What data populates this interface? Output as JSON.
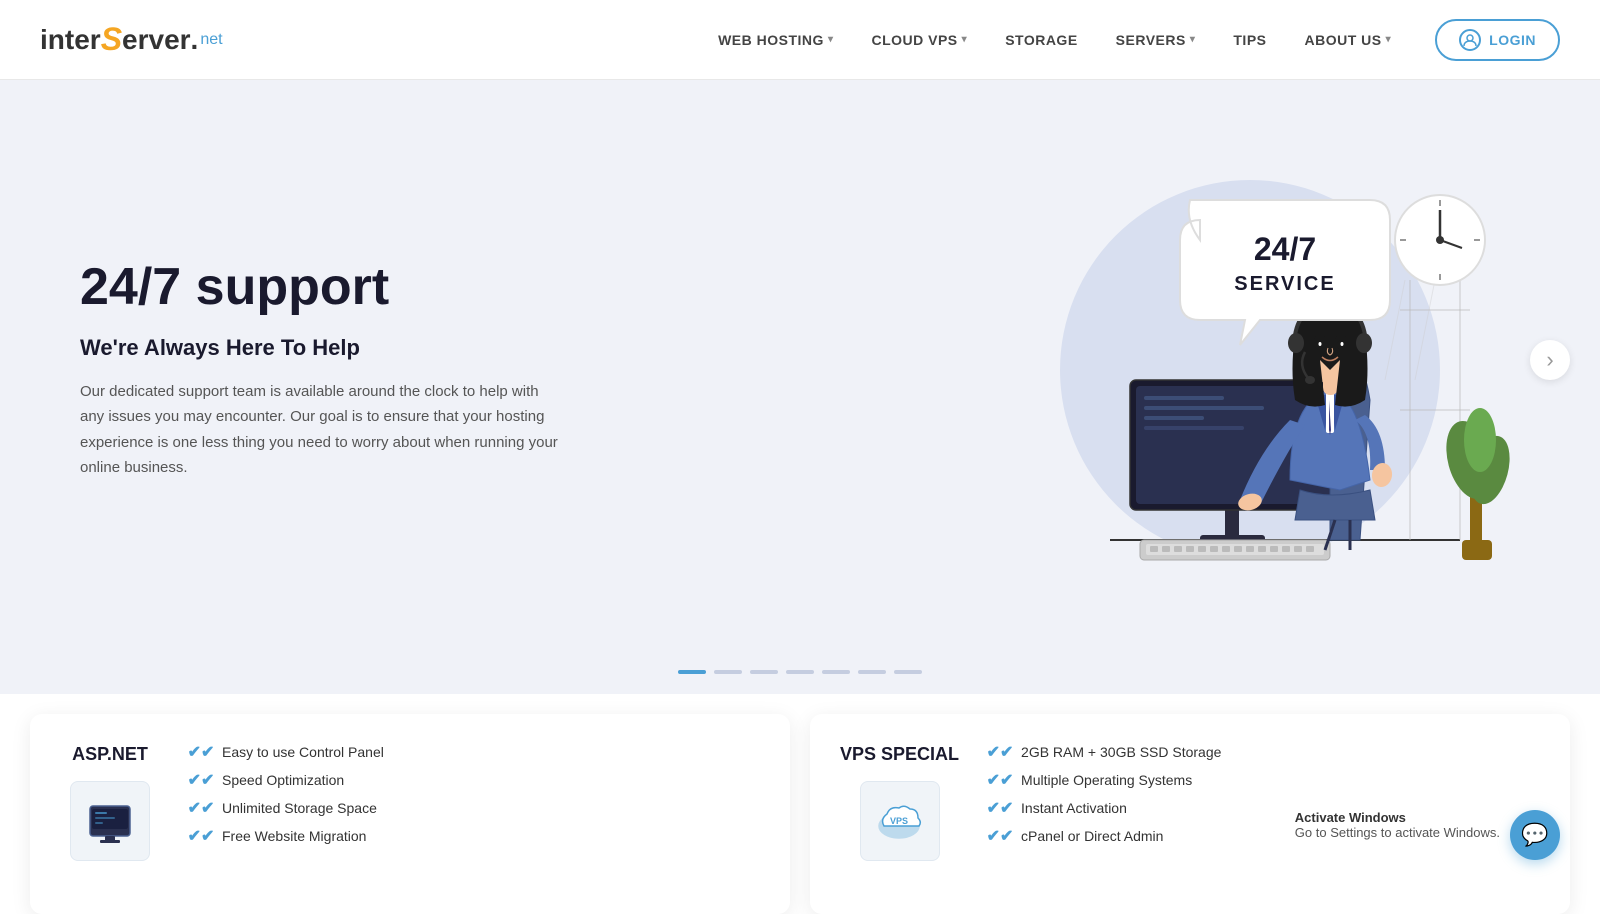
{
  "header": {
    "logo": {
      "inter": "inter",
      "s": "S",
      "erver": "erver",
      "dot": ".",
      "net": "net"
    },
    "nav": [
      {
        "label": "WEB HOSTING",
        "has_dropdown": true
      },
      {
        "label": "CLOUD VPS",
        "has_dropdown": true
      },
      {
        "label": "STORAGE",
        "has_dropdown": false
      },
      {
        "label": "SERVERS",
        "has_dropdown": true
      },
      {
        "label": "TIPS",
        "has_dropdown": false
      },
      {
        "label": "ABOUT US",
        "has_dropdown": true
      }
    ],
    "login_label": "LOGIN"
  },
  "hero": {
    "title": "24/7 support",
    "subtitle": "We're Always Here To Help",
    "description": "Our dedicated support team is available around the clock to help with any issues you may encounter. Our goal is to ensure that your hosting experience is one less thing you need to worry about when running your online business.",
    "badge_line1": "24/7",
    "badge_line2": "SERVICE",
    "slide_count": 7,
    "active_slide": 1
  },
  "cards": [
    {
      "label": "ASP.NET",
      "features": [
        "Easy to use Control Panel",
        "Speed Optimization",
        "Unlimited Storage Space",
        "Free Website Migration"
      ]
    },
    {
      "label": "VPS SPECIAL",
      "features": [
        "2GB RAM + 30GB SSD Storage",
        "Multiple Operating Systems",
        "Instant Activation",
        "cPanel or Direct Admin"
      ]
    }
  ],
  "chat": {
    "icon": "💬"
  },
  "windows_watermark": {
    "line1": "Activate Windows",
    "line2": "Go to Settings to activate Windows."
  }
}
